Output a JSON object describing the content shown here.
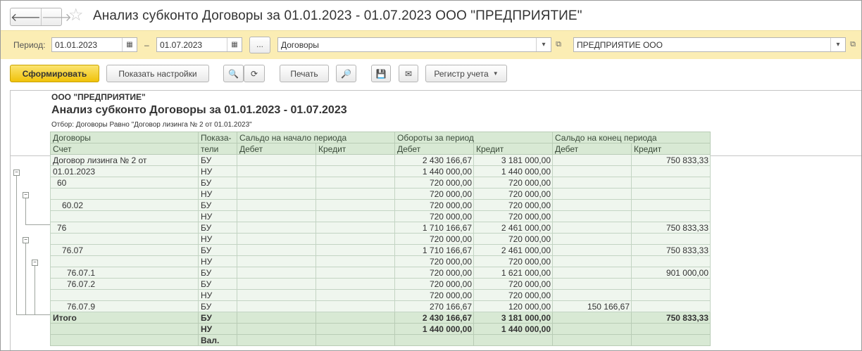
{
  "window": {
    "title": "Анализ субконто Договоры за 01.01.2023 - 01.07.2023 ООО \"ПРЕДПРИЯТИЕ\""
  },
  "nav": {
    "back": "🡐",
    "forward": "🡒",
    "favorite": "☆"
  },
  "params": {
    "period_label": "Период:",
    "date_from": "01.01.2023",
    "dash": "–",
    "date_to": "01.07.2023",
    "period_more": "...",
    "subconto": "Договоры",
    "organization": "ПРЕДПРИЯТИЕ ООО"
  },
  "toolbar": {
    "generate": "Сформировать",
    "show_settings": "Показать настройки",
    "print": "Печать",
    "register": "Регистр учета"
  },
  "icons": {
    "calendar": "▦",
    "dropdown": "▾",
    "open": "⧉",
    "search": "🔍",
    "search_next": "⟳",
    "preview": "🔎",
    "save": "💾",
    "mail": "✉"
  },
  "report": {
    "org": "ООО \"ПРЕДПРИЯТИЕ\"",
    "title": "Анализ субконто Договоры за 01.01.2023 - 01.07.2023",
    "filter": "Отбор: Договоры Равно \"Договор лизинга № 2 от 01.01.2023\"",
    "header": {
      "col1_top": "Договоры",
      "col1_bottom": "Счет",
      "ind_top": "Показа-",
      "ind_bottom": "тели",
      "open_balance": "Сальдо на начало периода",
      "turnover": "Обороты за период",
      "close_balance": "Сальдо на конец периода",
      "debit": "Дебет",
      "credit": "Кредит"
    },
    "rows": [
      {
        "name": "Договор лизинга № 2 от",
        "ind": "БУ",
        "ob_d": "",
        "ob_c": "",
        "t_d": "2 430 166,67",
        "t_c": "3 181 000,00",
        "cb_d": "",
        "cb_c": "750 833,33"
      },
      {
        "name": "01.01.2023",
        "ind": "НУ",
        "ob_d": "",
        "ob_c": "",
        "t_d": "1 440 000,00",
        "t_c": "1 440 000,00",
        "cb_d": "",
        "cb_c": ""
      },
      {
        "name": "60",
        "ind": "БУ",
        "ob_d": "",
        "ob_c": "",
        "t_d": "720 000,00",
        "t_c": "720 000,00",
        "cb_d": "",
        "cb_c": ""
      },
      {
        "name": "",
        "ind": "НУ",
        "ob_d": "",
        "ob_c": "",
        "t_d": "720 000,00",
        "t_c": "720 000,00",
        "cb_d": "",
        "cb_c": ""
      },
      {
        "name": "60.02",
        "ind": "БУ",
        "ob_d": "",
        "ob_c": "",
        "t_d": "720 000,00",
        "t_c": "720 000,00",
        "cb_d": "",
        "cb_c": ""
      },
      {
        "name": "",
        "ind": "НУ",
        "ob_d": "",
        "ob_c": "",
        "t_d": "720 000,00",
        "t_c": "720 000,00",
        "cb_d": "",
        "cb_c": ""
      },
      {
        "name": "76",
        "ind": "БУ",
        "ob_d": "",
        "ob_c": "",
        "t_d": "1 710 166,67",
        "t_c": "2 461 000,00",
        "cb_d": "",
        "cb_c": "750 833,33"
      },
      {
        "name": "",
        "ind": "НУ",
        "ob_d": "",
        "ob_c": "",
        "t_d": "720 000,00",
        "t_c": "720 000,00",
        "cb_d": "",
        "cb_c": ""
      },
      {
        "name": "76.07",
        "ind": "БУ",
        "ob_d": "",
        "ob_c": "",
        "t_d": "1 710 166,67",
        "t_c": "2 461 000,00",
        "cb_d": "",
        "cb_c": "750 833,33"
      },
      {
        "name": "",
        "ind": "НУ",
        "ob_d": "",
        "ob_c": "",
        "t_d": "720 000,00",
        "t_c": "720 000,00",
        "cb_d": "",
        "cb_c": ""
      },
      {
        "name": "76.07.1",
        "ind": "БУ",
        "ob_d": "",
        "ob_c": "",
        "t_d": "720 000,00",
        "t_c": "1 621 000,00",
        "cb_d": "",
        "cb_c": "901 000,00"
      },
      {
        "name": "76.07.2",
        "ind": "БУ",
        "ob_d": "",
        "ob_c": "",
        "t_d": "720 000,00",
        "t_c": "720 000,00",
        "cb_d": "",
        "cb_c": ""
      },
      {
        "name": "",
        "ind": "НУ",
        "ob_d": "",
        "ob_c": "",
        "t_d": "720 000,00",
        "t_c": "720 000,00",
        "cb_d": "",
        "cb_c": ""
      },
      {
        "name": "76.07.9",
        "ind": "БУ",
        "ob_d": "",
        "ob_c": "",
        "t_d": "270 166,67",
        "t_c": "120 000,00",
        "cb_d": "150 166,67",
        "cb_c": ""
      }
    ],
    "totals": [
      {
        "name": "Итого",
        "ind": "БУ",
        "ob_d": "",
        "ob_c": "",
        "t_d": "2 430 166,67",
        "t_c": "3 181 000,00",
        "cb_d": "",
        "cb_c": "750 833,33"
      },
      {
        "name": "",
        "ind": "НУ",
        "ob_d": "",
        "ob_c": "",
        "t_d": "1 440 000,00",
        "t_c": "1 440 000,00",
        "cb_d": "",
        "cb_c": ""
      },
      {
        "name": "",
        "ind": "Вал.",
        "ob_d": "",
        "ob_c": "",
        "t_d": "",
        "t_c": "",
        "cb_d": "",
        "cb_c": ""
      }
    ]
  }
}
